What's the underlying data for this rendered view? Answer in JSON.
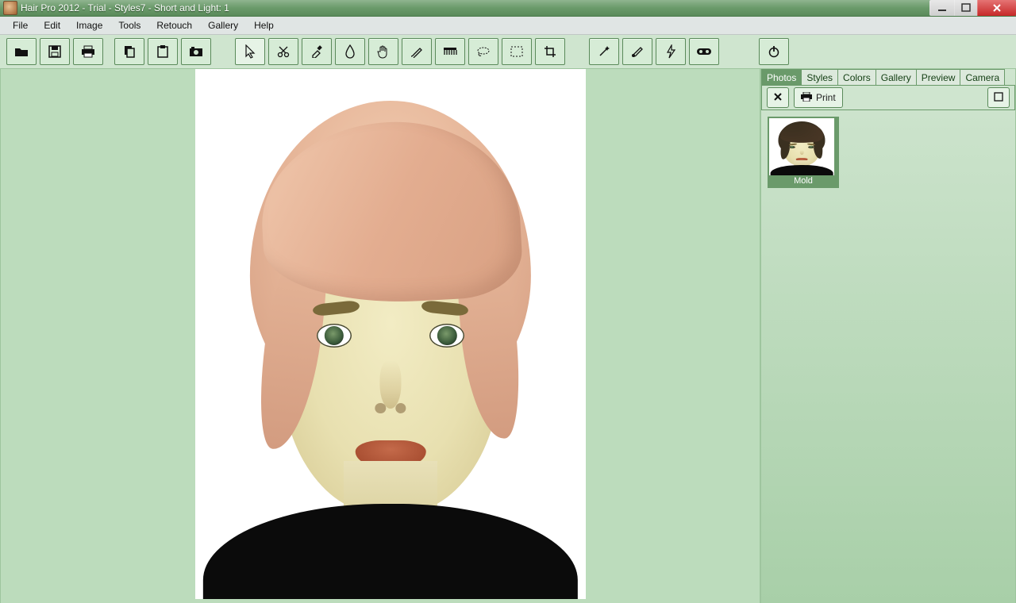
{
  "window": {
    "title": "Hair Pro 2012 - Trial - Styles7 - Short and Light: 1"
  },
  "menubar": {
    "items": [
      {
        "label": "File"
      },
      {
        "label": "Edit"
      },
      {
        "label": "Image"
      },
      {
        "label": "Tools"
      },
      {
        "label": "Retouch"
      },
      {
        "label": "Gallery"
      },
      {
        "label": "Help"
      }
    ]
  },
  "toolbar": {
    "group1": [
      {
        "name": "open-icon"
      },
      {
        "name": "save-icon"
      },
      {
        "name": "print-icon"
      },
      {
        "name": "copy-icon"
      },
      {
        "name": "paste-icon"
      },
      {
        "name": "camera-icon"
      }
    ],
    "group2": [
      {
        "name": "pointer-icon",
        "active": true
      },
      {
        "name": "scissor-icon"
      },
      {
        "name": "eyedropper-icon"
      },
      {
        "name": "droplet-icon"
      },
      {
        "name": "hand-icon"
      },
      {
        "name": "brush-icon"
      },
      {
        "name": "comb-icon"
      },
      {
        "name": "lasso-icon"
      },
      {
        "name": "marquee-icon"
      },
      {
        "name": "crop-icon"
      }
    ],
    "group3": [
      {
        "name": "wand-icon"
      },
      {
        "name": "paint-icon"
      },
      {
        "name": "bolt-icon"
      },
      {
        "name": "mask-icon"
      }
    ],
    "group4": [
      {
        "name": "power-icon"
      }
    ]
  },
  "side": {
    "tabs": [
      {
        "label": "Photos",
        "active": true
      },
      {
        "label": "Styles"
      },
      {
        "label": "Colors"
      },
      {
        "label": "Gallery"
      },
      {
        "label": "Preview"
      },
      {
        "label": "Camera"
      }
    ],
    "buttons": {
      "print": "Print"
    },
    "thumbs": [
      {
        "label": "Mold"
      }
    ]
  }
}
